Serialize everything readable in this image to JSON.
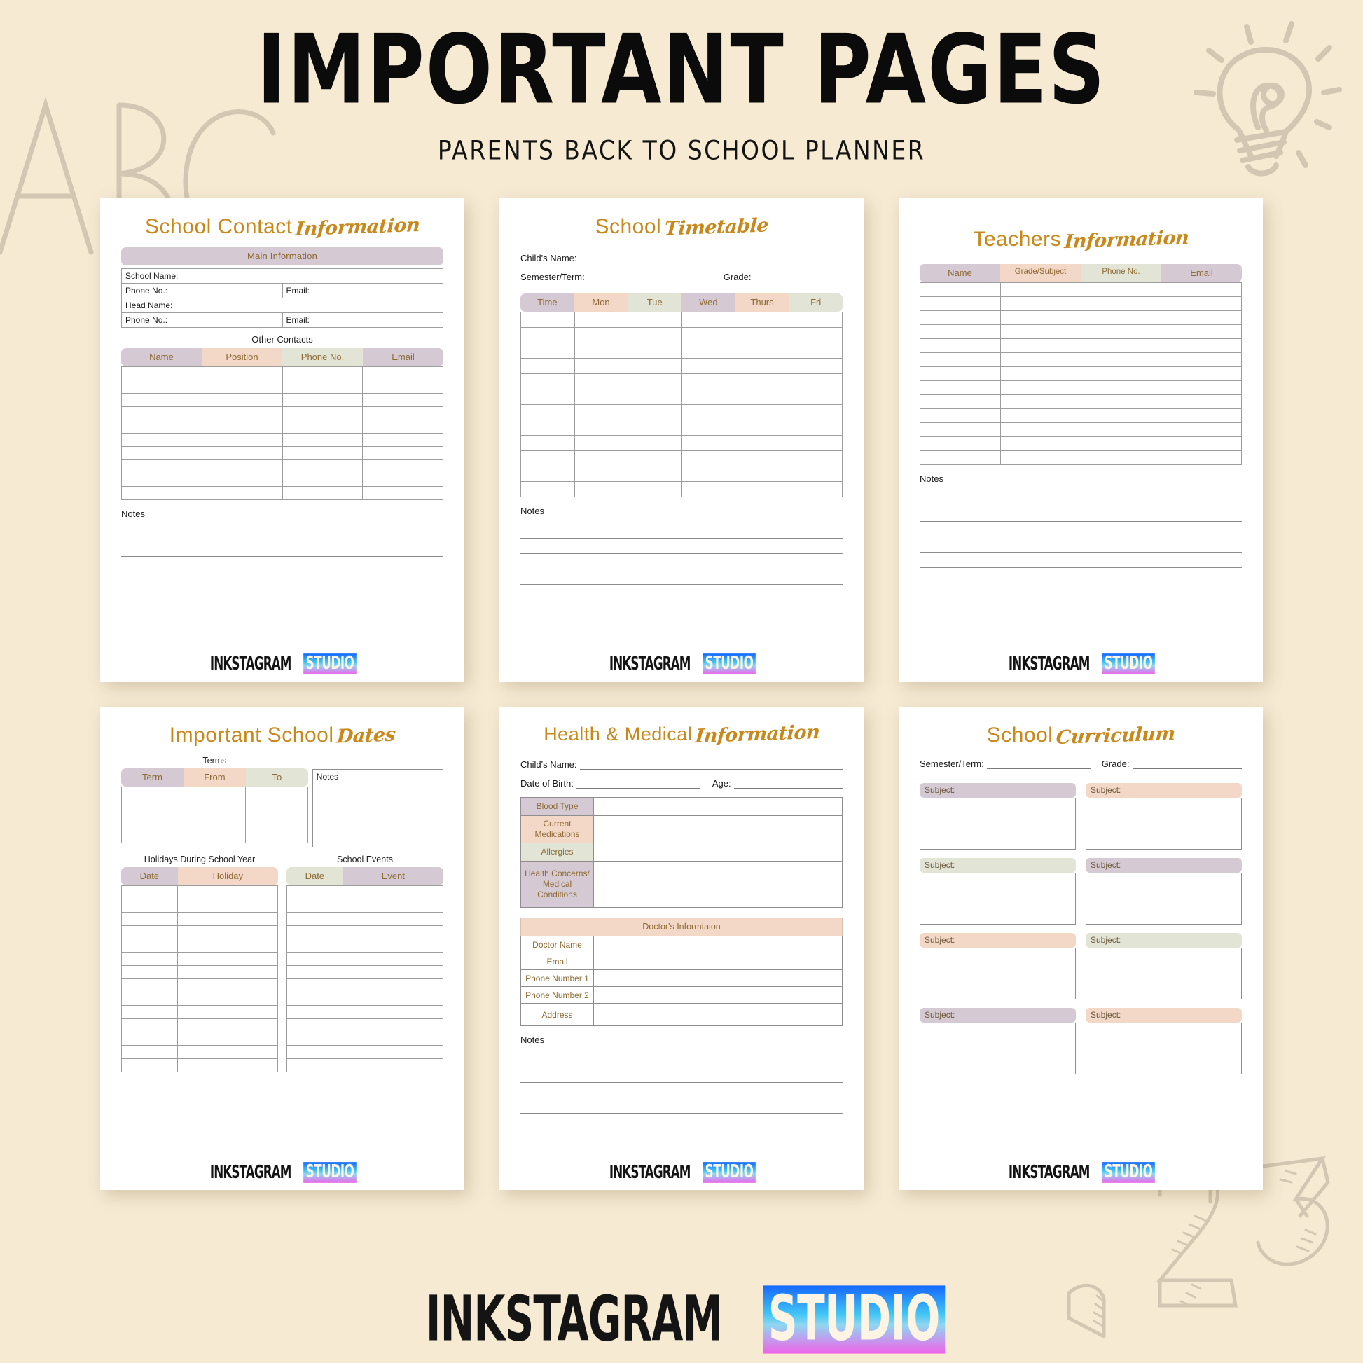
{
  "header": {
    "title": "IMPORTANT PAGES",
    "subtitle": "PARENTS BACK TO SCHOOL PLANNER"
  },
  "brand": {
    "name_dark": "INKSTAGRAM",
    "name_light": "STUDIO"
  },
  "colors": {
    "background": "#f6ead3",
    "accent_gold": "#c9881b",
    "lilac": "#d5c9d3",
    "peach": "#f3d8c8",
    "sage": "#e2e4d6",
    "doodle": "#cdc2ae",
    "logo_gradient_start": "#1668ff",
    "logo_gradient_mid": "#41c6f5",
    "logo_gradient_end": "#ef63e8"
  },
  "doodles": [
    {
      "name": "abc-doodle",
      "label": "ABC"
    },
    {
      "name": "lightbulb-doodle",
      "label": "lightbulb"
    },
    {
      "name": "123-doodle",
      "label": "123"
    }
  ],
  "sheets": [
    {
      "id": "school-contact-information",
      "title_plain": "School Contact",
      "title_script": "Information",
      "main_band": "Main Information",
      "main_rows": [
        {
          "cells": [
            "School Name:"
          ]
        },
        {
          "cells": [
            "Phone No.:",
            "Email:"
          ]
        },
        {
          "cells": [
            "Head Name:"
          ]
        },
        {
          "cells": [
            "Phone No.:",
            "Email:"
          ]
        }
      ],
      "other_label": "Other Contacts",
      "other_headers": [
        "Name",
        "Position",
        "Phone No.",
        "Email"
      ],
      "other_header_colors": [
        "lilac",
        "peach",
        "sage",
        "lilac"
      ],
      "other_rows": 10,
      "notes_label": "Notes",
      "notes_lines": 3
    },
    {
      "id": "school-timetable",
      "title_plain": "School",
      "title_script": "Timetable",
      "fields": [
        {
          "label": "Child's Name:",
          "value": "",
          "rule": "long"
        },
        {
          "label": "Semester/Term:",
          "value": "",
          "rule": "short",
          "label2": "Grade:",
          "value2": ""
        }
      ],
      "headers": [
        "Time",
        "Mon",
        "Tue",
        "Wed",
        "Thurs",
        "Fri"
      ],
      "header_colors": [
        "lilac",
        "peach",
        "sage",
        "lilac",
        "peach",
        "sage"
      ],
      "rows": 12,
      "notes_label": "Notes",
      "notes_lines": 4
    },
    {
      "id": "teachers-information",
      "title_plain": "Teachers",
      "title_script": "Information",
      "headers": [
        "Name",
        "Grade/Subject",
        "Phone No.",
        "Email"
      ],
      "header_colors": [
        "lilac",
        "peach",
        "sage",
        "lilac"
      ],
      "rows": 13,
      "notes_label": "Notes",
      "notes_lines": 5
    },
    {
      "id": "important-school-dates",
      "title_plain": "Important School",
      "title_script": "Dates",
      "terms_label": "Terms",
      "terms_headers": [
        "Term",
        "From",
        "To"
      ],
      "terms_header_colors": [
        "lilac",
        "peach",
        "sage"
      ],
      "terms_rows": 4,
      "notes_box_label": "Notes",
      "holidays_label": "Holidays During School Year",
      "holidays_headers": [
        "Date",
        "Holiday"
      ],
      "holidays_header_colors": [
        "lilac",
        "peach"
      ],
      "holidays_rows": 14,
      "events_label": "School Events",
      "events_headers": [
        "Date",
        "Event"
      ],
      "events_header_colors": [
        "sage",
        "lilac"
      ],
      "events_rows": 14
    },
    {
      "id": "health-medical-information",
      "title_plain": "Health & Medical",
      "title_script": "Information",
      "fields": [
        {
          "label": "Child's Name:",
          "value": "",
          "rule": "long"
        },
        {
          "label": "Date of Birth:",
          "value": "",
          "rule": "short",
          "label2": "Age:",
          "value2": ""
        }
      ],
      "health_rows": [
        {
          "key": "Blood Type",
          "color": "lilac",
          "height": 26
        },
        {
          "key": "Current Medications",
          "color": "peach",
          "height": 34
        },
        {
          "key": "Allergies",
          "color": "sage",
          "height": 26
        },
        {
          "key": "Health Concerns/ Medical Conditions",
          "color": "lilac",
          "height": 64
        }
      ],
      "doctor_band": "Doctor's Informtaion",
      "doctor_rows": [
        "Doctor Name",
        "Email",
        "Phone Number 1",
        "Phone Number 2",
        "Address"
      ],
      "notes_label": "Notes",
      "notes_lines": 4
    },
    {
      "id": "school-curriculum",
      "title_plain": "School",
      "title_script": "Curriculum",
      "fields": [
        {
          "label": "Semester/Term:",
          "value": "",
          "rule": "short",
          "label2": "Grade:",
          "value2": ""
        }
      ],
      "subject_label": "Subject:",
      "subjects": [
        {
          "color": "lilac"
        },
        {
          "color": "peach"
        },
        {
          "color": "sage"
        },
        {
          "color": "lilac"
        },
        {
          "color": "peach"
        },
        {
          "color": "sage"
        },
        {
          "color": "lilac"
        },
        {
          "color": "peach"
        }
      ]
    }
  ]
}
